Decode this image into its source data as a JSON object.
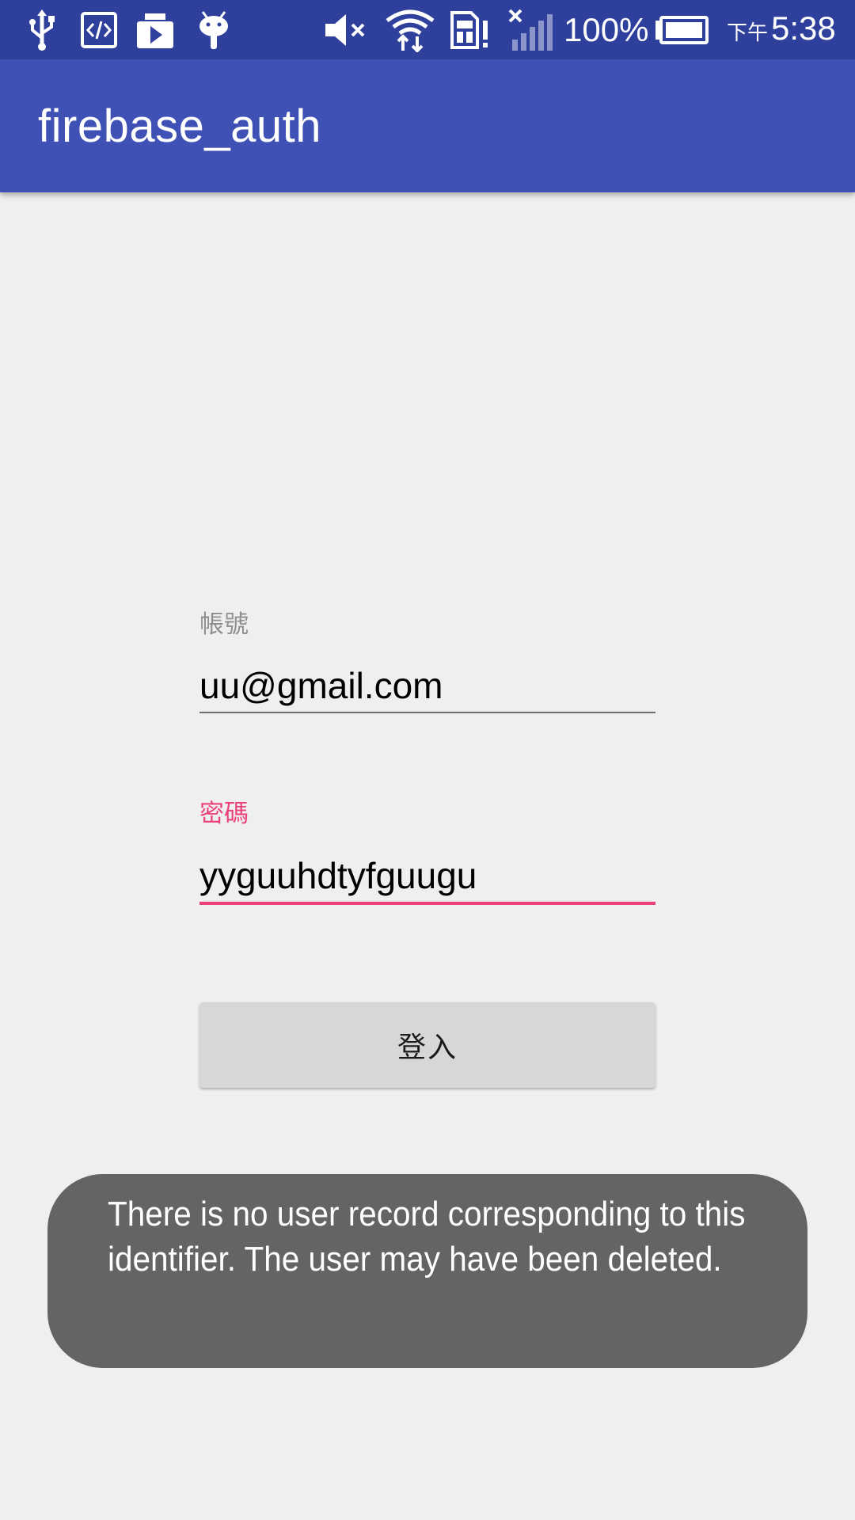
{
  "status_bar": {
    "icons": [
      "usb-icon",
      "developer-code-icon",
      "media-play-icon",
      "android-icon",
      "mute-icon",
      "wifi-icon",
      "sim-alert-icon",
      "no-signal-icon",
      "battery-icon"
    ],
    "battery_percent": "100%",
    "clock_ampm": "下午",
    "clock_time": "5:38",
    "background_color": "#2f3f9c"
  },
  "app_bar": {
    "title": "firebase_auth",
    "background_color": "#3f51b5"
  },
  "form": {
    "account": {
      "label": "帳號",
      "value": "uu@gmail.com",
      "label_color": "#8e8e8e"
    },
    "password": {
      "label": "密碼",
      "value": "yyguuhdtyfguugu",
      "label_color": "#ec407a"
    },
    "login_button_label": "登入"
  },
  "toast": {
    "message": "There is no user record corresponding to this identifier. The user may have been deleted."
  },
  "colors": {
    "accent": "#ec407a",
    "page_background": "#efefef"
  }
}
